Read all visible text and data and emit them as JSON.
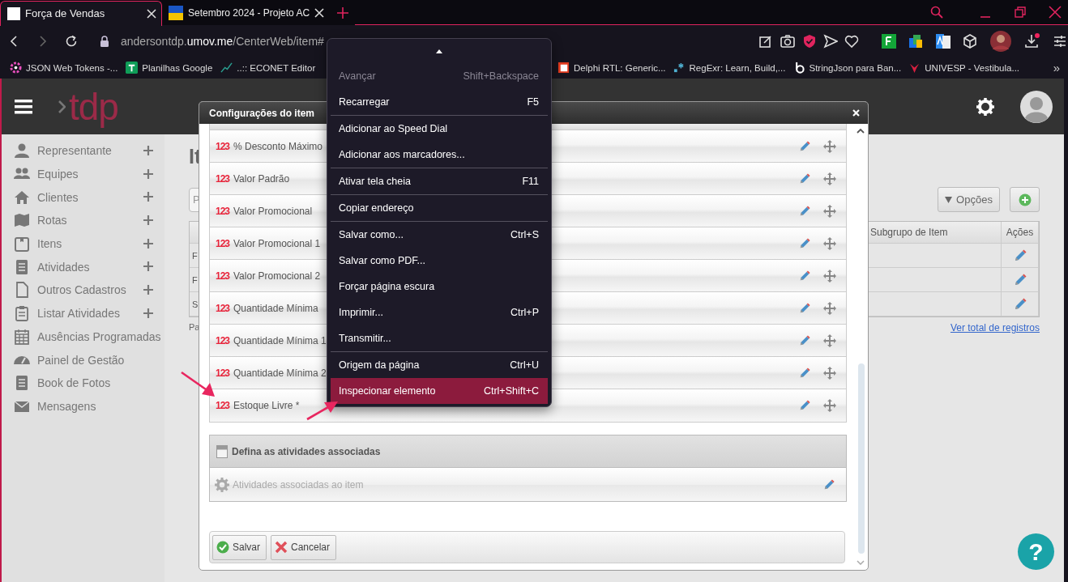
{
  "browser": {
    "tabs": [
      {
        "title": "Força de Vendas",
        "selected": true
      },
      {
        "title": "Setembro 2024 - Projeto AC",
        "selected": false
      }
    ],
    "address": "andersontdp.**umov.me**/CenterWeb/item#",
    "bookmarks": [
      "JSON Web Tokens -...",
      "Planilhas Google",
      "..:: ECONET Editor",
      "Delphi RTL: Generic...",
      "RegExr: Learn, Build,...",
      "StringJson para Ban...",
      "UNIVESP - Vestibula..."
    ],
    "bookmarks_more": "»"
  },
  "app": {
    "logo": "tdp",
    "sidebar": [
      {
        "label": "Representante",
        "expandable": true
      },
      {
        "label": "Equipes",
        "expandable": true
      },
      {
        "label": "Clientes",
        "expandable": true
      },
      {
        "label": "Rotas",
        "expandable": true
      },
      {
        "label": "Itens",
        "expandable": true
      },
      {
        "label": "Atividades",
        "expandable": true
      },
      {
        "label": "Outros Cadastros",
        "expandable": true
      },
      {
        "label": "Listar Atividades",
        "expandable": true
      },
      {
        "label": "Ausências Programadas",
        "expandable": false
      },
      {
        "label": "Painel de Gestão",
        "expandable": false
      },
      {
        "label": "Book de Fotos",
        "expandable": false
      },
      {
        "label": "Mensagens",
        "expandable": false
      }
    ],
    "page": {
      "heading": "It",
      "search_placeholder": "P",
      "options_button": "Opções",
      "table": {
        "columns": [
          "Subgrupo de Item",
          "Ações"
        ],
        "rows": [
          {
            "column_1": "F"
          },
          {
            "column_1": "F"
          },
          {
            "column_1": "S"
          }
        ]
      },
      "footer_text": "Pa",
      "total_link": "Ver total de registros"
    }
  },
  "dialog": {
    "title": "Configurações do item",
    "fields": [
      {
        "badge": "123",
        "label": "% Desconto Máximo"
      },
      {
        "badge": "123",
        "label": "Valor Padrão"
      },
      {
        "badge": "123",
        "label": "Valor Promocional"
      },
      {
        "badge": "123",
        "label": "Valor Promocional 1"
      },
      {
        "badge": "123",
        "label": "Valor Promocional 2"
      },
      {
        "badge": "123",
        "label": "Quantidade Mínima"
      },
      {
        "badge": "123",
        "label": "Quantidade Mínima 1"
      },
      {
        "badge": "123",
        "label": "Quantidade Mínima 2"
      },
      {
        "badge": "123",
        "label": "Estoque Livre *"
      }
    ],
    "section": {
      "title": "Defina as atividades associadas",
      "row": "Atividades associadas ao item"
    },
    "buttons": [
      {
        "label": "Salvar",
        "kind": "save"
      },
      {
        "label": "Cancelar",
        "kind": "cancel"
      }
    ]
  },
  "context_menu": {
    "items": [
      {
        "label": "Avançar",
        "shortcut": "Shift+Backspace",
        "disabled": true,
        "selected": false,
        "separator_after": false
      },
      {
        "label": "Recarregar",
        "shortcut": "F5",
        "disabled": false,
        "selected": false,
        "separator_after": true
      },
      {
        "label": "Adicionar ao Speed Dial",
        "disabled": false,
        "selected": false,
        "separator_after": false
      },
      {
        "label": "Adicionar aos marcadores...",
        "disabled": false,
        "selected": false,
        "separator_after": true
      },
      {
        "label": "Ativar tela cheia",
        "shortcut": "F11",
        "disabled": false,
        "selected": false,
        "separator_after": true
      },
      {
        "label": "Copiar endereço",
        "disabled": false,
        "selected": false,
        "separator_after": true
      },
      {
        "label": "Salvar como...",
        "shortcut": "Ctrl+S",
        "disabled": false,
        "selected": false,
        "separator_after": false
      },
      {
        "label": "Salvar como PDF...",
        "disabled": false,
        "selected": false,
        "separator_after": false
      },
      {
        "label": "Forçar página escura",
        "disabled": false,
        "selected": false,
        "separator_after": false
      },
      {
        "label": "Imprimir...",
        "shortcut": "Ctrl+P",
        "disabled": false,
        "selected": false,
        "separator_after": false
      },
      {
        "label": "Transmitir...",
        "disabled": false,
        "selected": false,
        "separator_after": true
      },
      {
        "label": "Origem da página",
        "shortcut": "Ctrl+U",
        "disabled": false,
        "selected": false,
        "separator_after": false
      },
      {
        "label": "Inspecionar elemento",
        "shortcut": "Ctrl+Shift+C",
        "disabled": false,
        "selected": true,
        "separator_after": false
      }
    ]
  },
  "help_button": "?"
}
